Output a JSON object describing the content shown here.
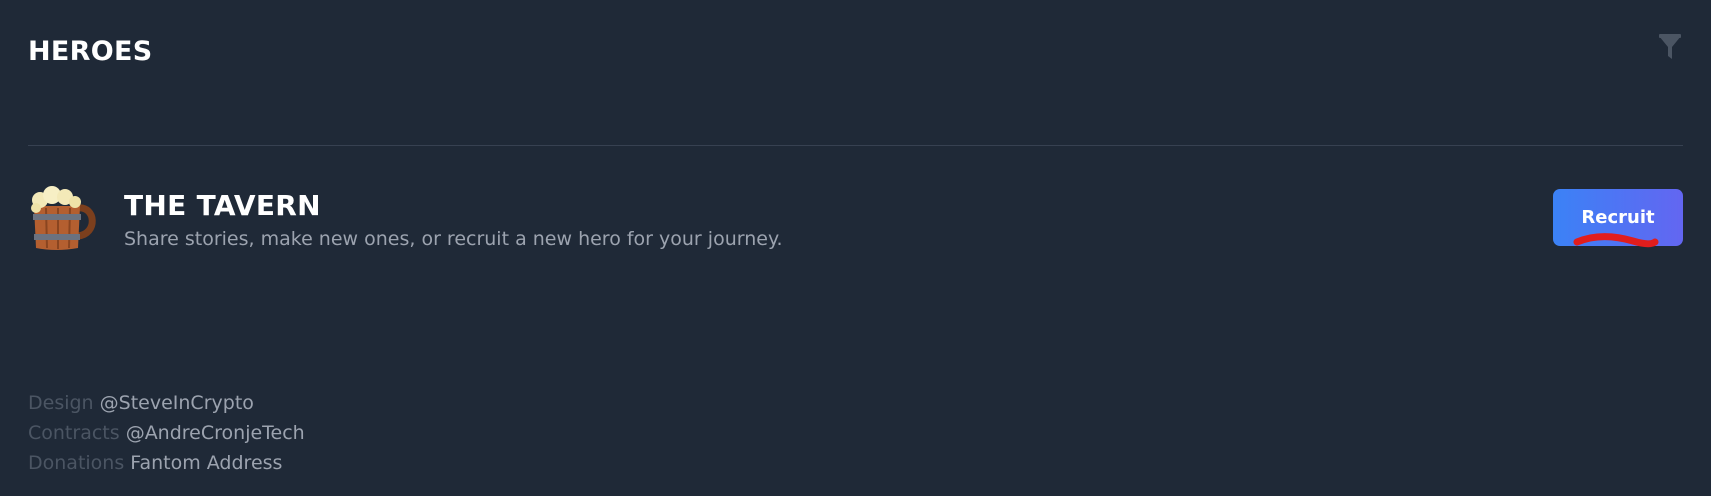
{
  "header": {
    "title": "HEROES",
    "filter_icon": "filter-icon"
  },
  "tavern": {
    "icon": "beer-mug-icon",
    "title": "THE TAVERN",
    "description": "Share stories, make new ones, or recruit a new hero for your journey.",
    "recruit_label": "Recruit"
  },
  "footer": {
    "rows": [
      {
        "label": "Design",
        "link": "@SteveInCrypto"
      },
      {
        "label": "Contracts",
        "link": "@AndreCronjeTech"
      },
      {
        "label": "Donations",
        "link": "Fantom Address"
      }
    ]
  },
  "colors": {
    "background": "#1f2937",
    "button_gradient_start": "#3b82f6",
    "button_gradient_end": "#6366f1",
    "annotation": "#e11d1d"
  }
}
